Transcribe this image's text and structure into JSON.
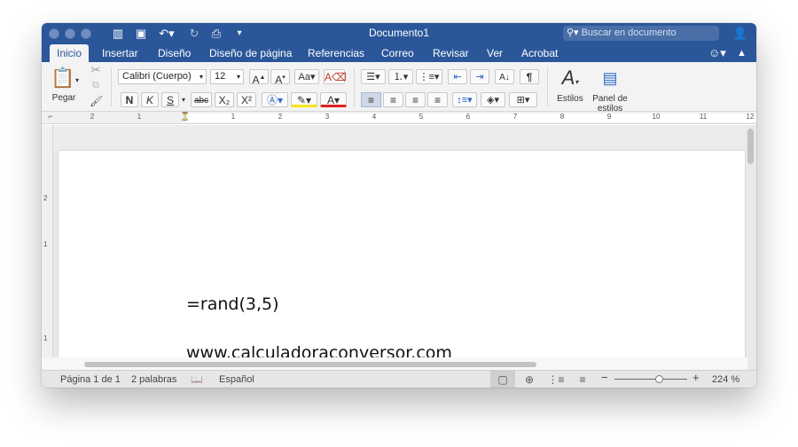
{
  "window": {
    "title": "Documento1"
  },
  "search": {
    "placeholder": "Buscar en documento"
  },
  "tabs": [
    {
      "label": "Inicio"
    },
    {
      "label": "Insertar"
    },
    {
      "label": "Diseño"
    },
    {
      "label": "Diseño de página"
    },
    {
      "label": "Referencias"
    },
    {
      "label": "Correo"
    },
    {
      "label": "Revisar"
    },
    {
      "label": "Ver"
    },
    {
      "label": "Acrobat"
    }
  ],
  "ribbon": {
    "paste_label": "Pegar",
    "font_name": "Calibri (Cuerpo)",
    "font_size": "12",
    "bold": "N",
    "italic": "K",
    "underline": "S",
    "strike": "abc",
    "subscript": "X₂",
    "superscript": "X²",
    "styles_label": "Estilos",
    "styles_pane_label_1": "Panel de",
    "styles_pane_label_2": "estilos"
  },
  "ruler": {
    "left_numbers": [
      "2",
      "1"
    ],
    "right_numbers": [
      "1",
      "2",
      "3",
      "4",
      "5",
      "6",
      "7",
      "8",
      "9",
      "10",
      "11",
      "12"
    ]
  },
  "vruler": {
    "numbers": [
      "2",
      "1",
      "1"
    ]
  },
  "document": {
    "lines": [
      "=rand(3,5)",
      "www.calculadoraconversor.com"
    ]
  },
  "status": {
    "page": "Página 1 de 1",
    "words": "2 palabras",
    "language": "Español",
    "zoom_minus": "−",
    "zoom_plus": "+",
    "zoom": "224 %"
  },
  "colors": {
    "brand": "#2b579a",
    "highlight": "#f5e51a",
    "font_color": "#e02020"
  }
}
